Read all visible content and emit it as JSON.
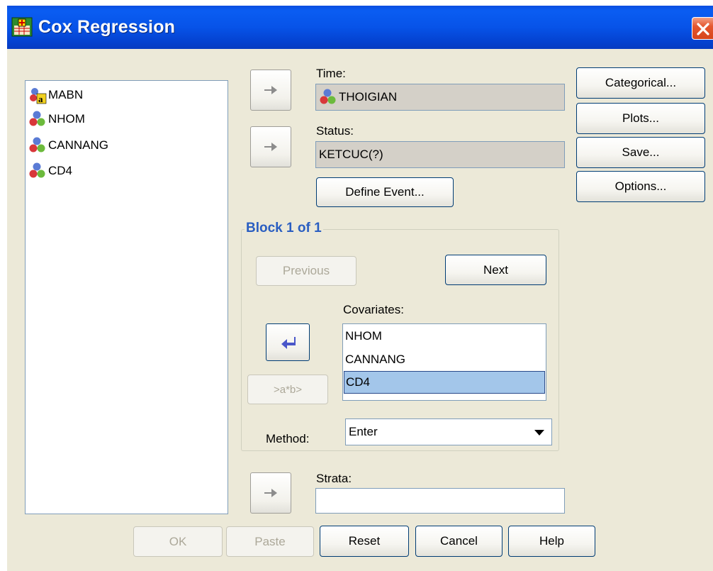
{
  "window": {
    "title": "Cox Regression"
  },
  "variables": [
    {
      "name": "MABN",
      "icon": "string-variable-icon"
    },
    {
      "name": "NHOM",
      "icon": "scale-variable-icon"
    },
    {
      "name": "CANNANG",
      "icon": "scale-variable-icon"
    },
    {
      "name": "CD4",
      "icon": "scale-variable-icon"
    }
  ],
  "time": {
    "label": "Time:",
    "value": "THOIGIAN"
  },
  "status": {
    "label": "Status:",
    "value": "KETCUC(?)"
  },
  "buttons": {
    "define_event": "Define Event...",
    "categorical": "Categorical...",
    "plots": "Plots...",
    "save": "Save...",
    "options": "Options...",
    "previous": "Previous",
    "next": "Next",
    "interaction": ">a*b>",
    "ok": "OK",
    "paste": "Paste",
    "reset": "Reset",
    "cancel": "Cancel",
    "help": "Help"
  },
  "block": {
    "title": "Block 1 of 1"
  },
  "covariates": {
    "label": "Covariates:",
    "items": [
      "NHOM",
      "CANNANG",
      "CD4"
    ],
    "selected": "CD4"
  },
  "method": {
    "label": "Method:",
    "value": "Enter"
  },
  "strata": {
    "label": "Strata:",
    "value": ""
  },
  "colors": {
    "titlebar": "#0753e8",
    "accent": "#2a5ec1",
    "selection": "#a3c6ea",
    "dialog_bg": "#ece9d8"
  }
}
